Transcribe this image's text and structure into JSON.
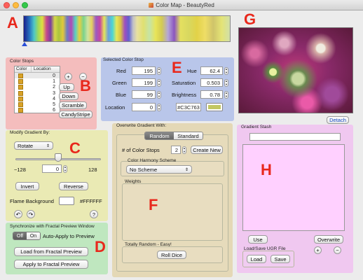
{
  "window": {
    "title": "Color Map - BeautyRed"
  },
  "letters": {
    "a": "A",
    "b": "B",
    "c": "C",
    "d": "D",
    "e": "E",
    "f": "F",
    "g": "G",
    "h": "H"
  },
  "color_stops": {
    "title": "Color Stops",
    "col_color": "Color",
    "col_location": "Location",
    "locations": [
      "0",
      "1",
      "2",
      "3",
      "4",
      "5",
      "6"
    ],
    "add_label": "+",
    "remove_label": "−",
    "up_label": "Up",
    "down_label": "Down",
    "scramble_label": "Scramble",
    "candystripe_label": "CandyStripe"
  },
  "selected_stop": {
    "title": "Selected Color Stop",
    "red_label": "Red",
    "red": "195",
    "green_label": "Green",
    "green": "199",
    "blue_label": "Blue",
    "blue": "99",
    "location_label": "Location",
    "location": "0",
    "hue_label": "Hue",
    "hue": "62.4",
    "saturation_label": "Saturation",
    "saturation": "0.503",
    "brightness_label": "Brightness",
    "brightness": "0.78",
    "hex": "#C3C763",
    "swatch_color": "#C3C763"
  },
  "modify": {
    "title": "Modify Gradient By:",
    "mode": "Rotate",
    "min": "−128",
    "max": "128",
    "value": "0",
    "invert_label": "Invert",
    "reverse_label": "Reverse",
    "flame_bg_label": "Flame Background",
    "flame_bg_value": "#FFFFFF",
    "slider_fraction": 0.5,
    "help_label": "?"
  },
  "sync": {
    "title": "Synchronize with Fractal Preview Window",
    "off_label": "Off",
    "on_label": "On",
    "auto_apply_label": "Auto-Apply to Preview",
    "load_label": "Load from Fractal Preview",
    "apply_label": "Apply to Fractal Preview"
  },
  "overwrite": {
    "title": "Overwrite Gradient With:",
    "tab_random": "Random",
    "tab_standard": "Standard",
    "num_stops_label": "# of Color Stops",
    "num_stops": "2",
    "create_new_label": "Create New",
    "harmony_label": "Color Harmony Scheme",
    "harmony_value": "No Scheme",
    "weights_label": "Weights",
    "random_label": "Totally Random - Easy!",
    "roll_dice_label": "Roll Dice"
  },
  "stash": {
    "title": "Gradient Stash",
    "detach_label": "Detach",
    "use_label": "Use",
    "overwrite_label": "Overwrite",
    "load_save_label": "Load/Save UGR File",
    "plus_label": "+",
    "minus_label": "−",
    "load_label": "Load",
    "save_label": "Save"
  },
  "colors": {
    "panel_a": "#f4bdbd",
    "panel_e": "#b9c6ea",
    "panel_c": "#eaeab4",
    "panel_d": "#bfe7bf",
    "panel_f": "#e4d8b6",
    "panel_h": "#f0c8f0",
    "accent": "#e8281c"
  }
}
